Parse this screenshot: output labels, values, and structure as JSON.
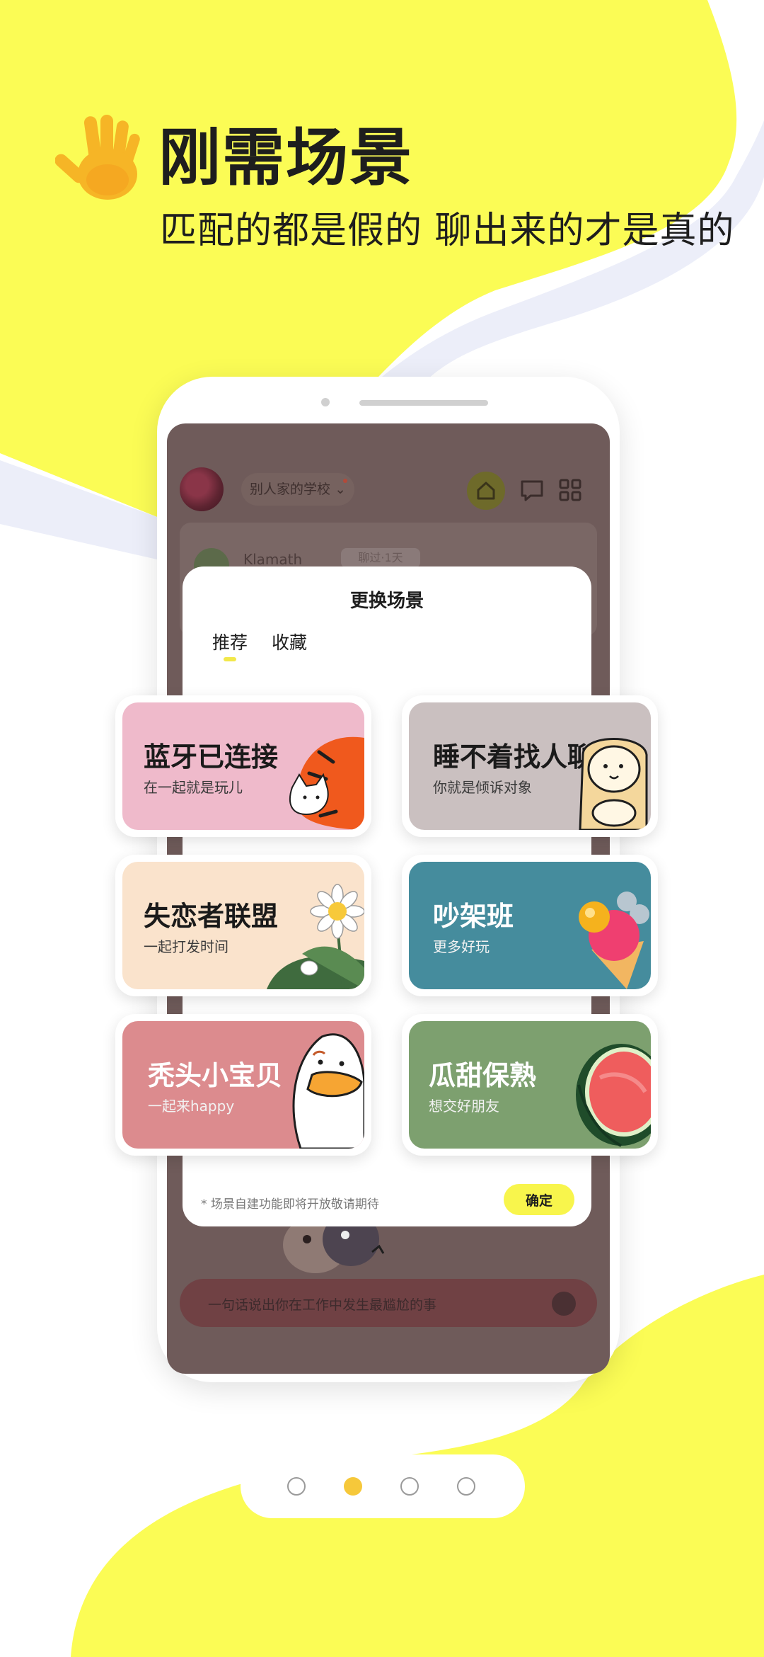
{
  "header": {
    "title": "刚需场景",
    "subtitle": "匹配的都是假的 聊出来的才是真的"
  },
  "app": {
    "school": "别人家的学校",
    "feed_name": "Klamath",
    "feed_tag": "聊过·1天",
    "input_placeholder": "一句话说出你在工作中发生最尴尬的事"
  },
  "modal": {
    "title": "更换场景",
    "tabs": [
      {
        "label": "推荐",
        "active": true
      },
      {
        "label": "收藏",
        "active": false
      }
    ],
    "footnote": "* 场景自建功能即将开放敬请期待",
    "confirm_label": "确定"
  },
  "scenes": [
    {
      "title": "蓝牙已连接",
      "subtitle": "在一起就是玩儿",
      "color": "#efbacb"
    },
    {
      "title": "睡不着找人聊",
      "subtitle": "你就是倾诉对象",
      "color": "#cac0c0"
    },
    {
      "title": "失恋者联盟",
      "subtitle": "一起打发时间",
      "color": "#fae3cc"
    },
    {
      "title": "吵架班",
      "subtitle": "更多好玩",
      "color": "#458c9d"
    },
    {
      "title": "秃头小宝贝",
      "subtitle": "一起来happy",
      "color": "#dc8b8e"
    },
    {
      "title": "瓜甜保熟",
      "subtitle": "想交好朋友",
      "color": "#7da06f"
    }
  ],
  "pager": {
    "total": 4,
    "active_index": 1
  },
  "colors": {
    "brand_yellow": "#fbfc55",
    "wave": "#eceef9",
    "active_dot": "#f6c83a"
  },
  "icons": {
    "hand": "waving-hand-icon",
    "home": "home-icon",
    "chat": "chat-bubble-icon",
    "grid": "grid-icon"
  }
}
